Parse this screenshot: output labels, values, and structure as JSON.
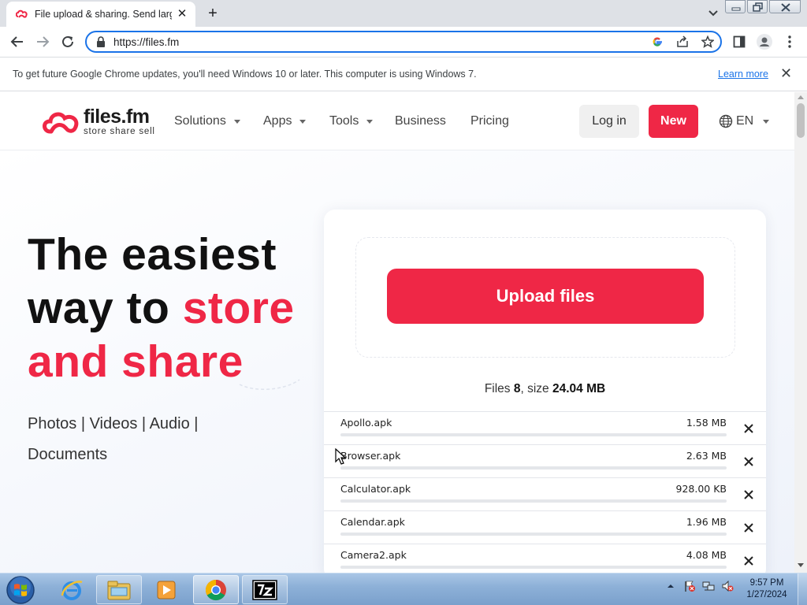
{
  "browser": {
    "tab_title": "File upload & sharing. Send large",
    "url": "https://files.fm",
    "infobar_message": "To get future Google Chrome updates, you'll need Windows 10 or later. This computer is using Windows 7.",
    "infobar_link": "Learn more",
    "icons": [
      "back-icon",
      "forward-icon",
      "reload-icon",
      "lock-icon",
      "google-icon",
      "share-icon",
      "star-icon",
      "side-panel-icon",
      "profile-icon",
      "menu-icon"
    ]
  },
  "site": {
    "logo_name": "files.fm",
    "logo_tagline": "store  share  sell",
    "nav": {
      "solutions": "Solutions",
      "apps": "Apps",
      "tools": "Tools",
      "business": "Business",
      "pricing": "Pricing"
    },
    "login": "Log in",
    "new": "New",
    "lang": "EN",
    "accent_color": "#ef2746"
  },
  "hero": {
    "line1": "The easiest",
    "line2_plain": "way to ",
    "line2_red": "store",
    "line3_red": "and share",
    "sub_line1": "Photos  |  Videos  |  Audio  |",
    "sub_line2": "Documents"
  },
  "upload": {
    "button": "Upload files",
    "summary_files_label": "Files",
    "summary_files_count": "8",
    "summary_size_label": ", size",
    "summary_size_value": "24.04 MB",
    "files": [
      {
        "name": "Apollo.apk",
        "size": "1.58 MB"
      },
      {
        "name": "Browser.apk",
        "size": "2.63 MB"
      },
      {
        "name": "Calculator.apk",
        "size": "928.00 KB"
      },
      {
        "name": "Calendar.apk",
        "size": "1.96 MB"
      },
      {
        "name": "Camera2.apk",
        "size": "4.08 MB"
      }
    ]
  },
  "taskbar": {
    "time": "9:57 PM",
    "date": "1/27/2024",
    "items": [
      "internet-explorer-icon",
      "file-explorer-icon",
      "media-player-icon",
      "chrome-icon",
      "7zip-icon"
    ]
  }
}
